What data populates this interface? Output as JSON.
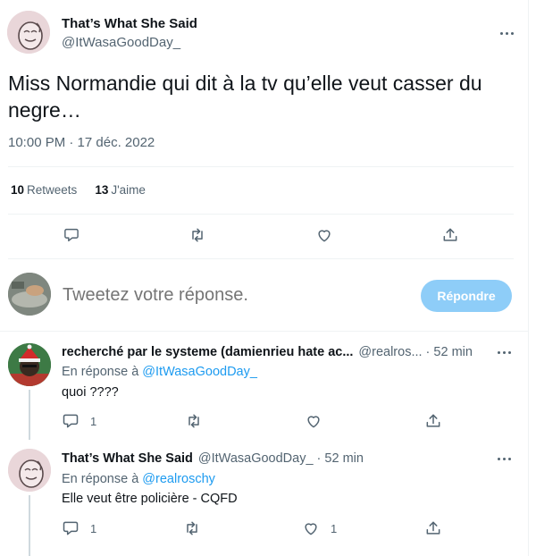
{
  "main_tweet": {
    "name": "That’s What She Said",
    "handle": "@ItWasaGoodDay_",
    "text": "Miss Normandie qui dit à la tv qu’elle veut casser du negre…",
    "timestamp": "10:00 PM · 17 déc. 2022",
    "retweets_count": "10",
    "retweets_label": "Retweets",
    "likes_count": "13",
    "likes_label": "J'aime"
  },
  "composer": {
    "placeholder": "Tweetez votre réponse.",
    "button_label": "Répondre"
  },
  "replies": [
    {
      "name": "recherché par le systeme (damienrieu hate ac...",
      "handle": "@realros... · 52 min",
      "replying_prefix": "En réponse à ",
      "replying_to": "@ItWasaGoodDay_",
      "text": "quoi ????",
      "reply_count": "1",
      "retweet_count": "",
      "like_count": ""
    },
    {
      "name": "That’s What She Said",
      "handle": "@ItWasaGoodDay_ · 52 min",
      "replying_prefix": "En réponse à ",
      "replying_to": "@realroschy",
      "text": "Elle veut être policière - CQFD",
      "reply_count": "1",
      "retweet_count": "",
      "like_count": "1"
    }
  ],
  "colors": {
    "accent": "#1d9bf0",
    "button_disabled": "#8ecdf8",
    "secondary_text": "#536471",
    "divider": "#eff3f4"
  },
  "icons": [
    "more-icon",
    "reply-icon",
    "retweet-icon",
    "like-icon",
    "share-icon"
  ]
}
